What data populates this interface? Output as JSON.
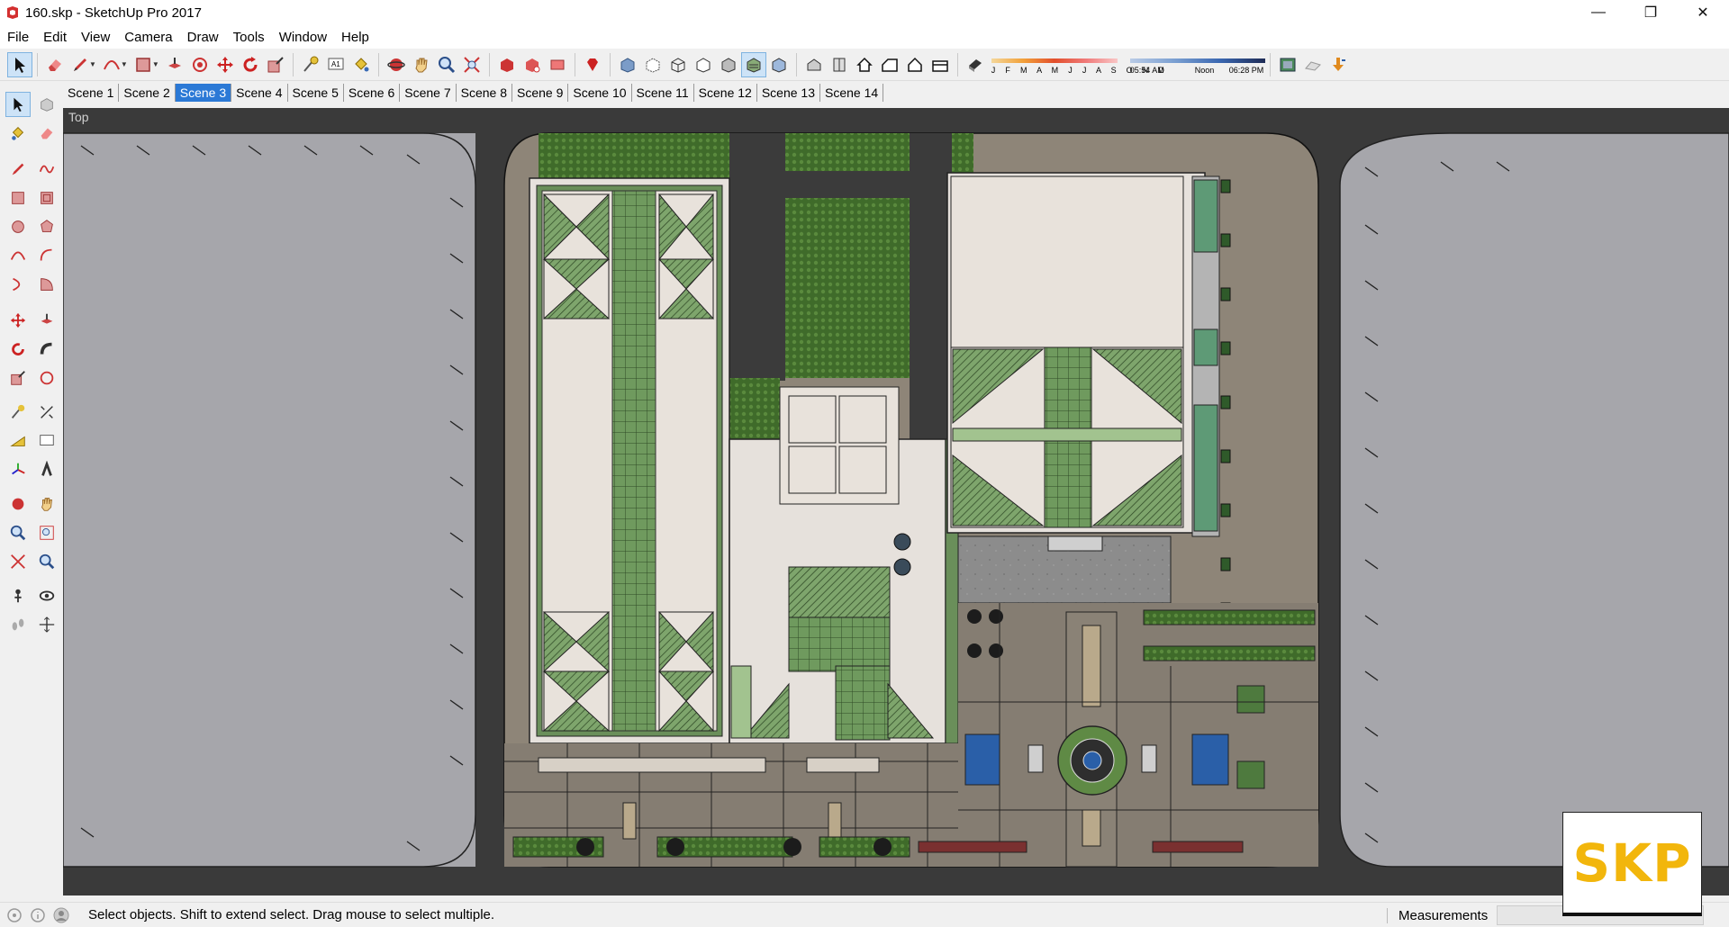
{
  "window": {
    "title": "160.skp - SketchUp Pro 2017",
    "minimize_glyph": "—",
    "restore_glyph": "❐",
    "close_glyph": "✕"
  },
  "menu": [
    "File",
    "Edit",
    "View",
    "Camera",
    "Draw",
    "Tools",
    "Window",
    "Help"
  ],
  "shadows": {
    "months": "J F M A M J J A S O N D",
    "time_start": "05:54 AM",
    "time_mid": "Noon",
    "time_end": "06:28 PM"
  },
  "scenes": [
    "Scene 1",
    "Scene 2",
    "Scene 3",
    "Scene 4",
    "Scene 5",
    "Scene 6",
    "Scene 7",
    "Scene 8",
    "Scene 9",
    "Scene 10",
    "Scene 11",
    "Scene 12",
    "Scene 13",
    "Scene 14"
  ],
  "active_scene": "Scene 3",
  "viewport": {
    "view_name": "Top"
  },
  "status": {
    "hint": "Select objects. Shift to extend select. Drag mouse to select multiple.",
    "measurements_label": "Measurements",
    "measurements_value": ""
  },
  "logo": {
    "text": "SKP",
    "color": "#f2b60c"
  },
  "colors": {
    "road": "#3a3a3a",
    "sidewalk": "#a6a6ab",
    "roof": "#e8e2db",
    "grass": "#3f6b2a",
    "green_tiles": "#6f9a5e",
    "plaza": "#8e8578",
    "water": "#2a5fa8",
    "selection": "#2b79d6"
  }
}
